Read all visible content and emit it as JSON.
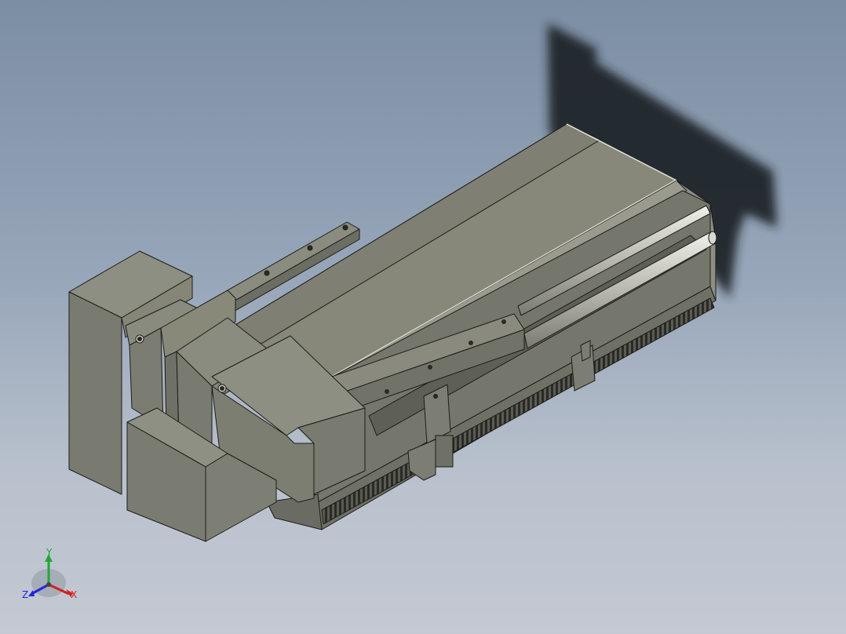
{
  "viewport": {
    "name": "cad-3d-viewport",
    "background_top": "#7c8ea4",
    "background_bottom": "#c4c9d3"
  },
  "model": {
    "name": "linear-actuator-assembly",
    "body_color": "#7a7b70",
    "top_color": "#868779",
    "rail_color": "#c9c9c2",
    "shadow_color": "#1f2228"
  },
  "triad": {
    "labels": {
      "x": "X",
      "y": "Y",
      "z": "Z"
    },
    "colors": {
      "x": "#d22020",
      "y": "#1fa83a",
      "z": "#2424d8"
    }
  }
}
